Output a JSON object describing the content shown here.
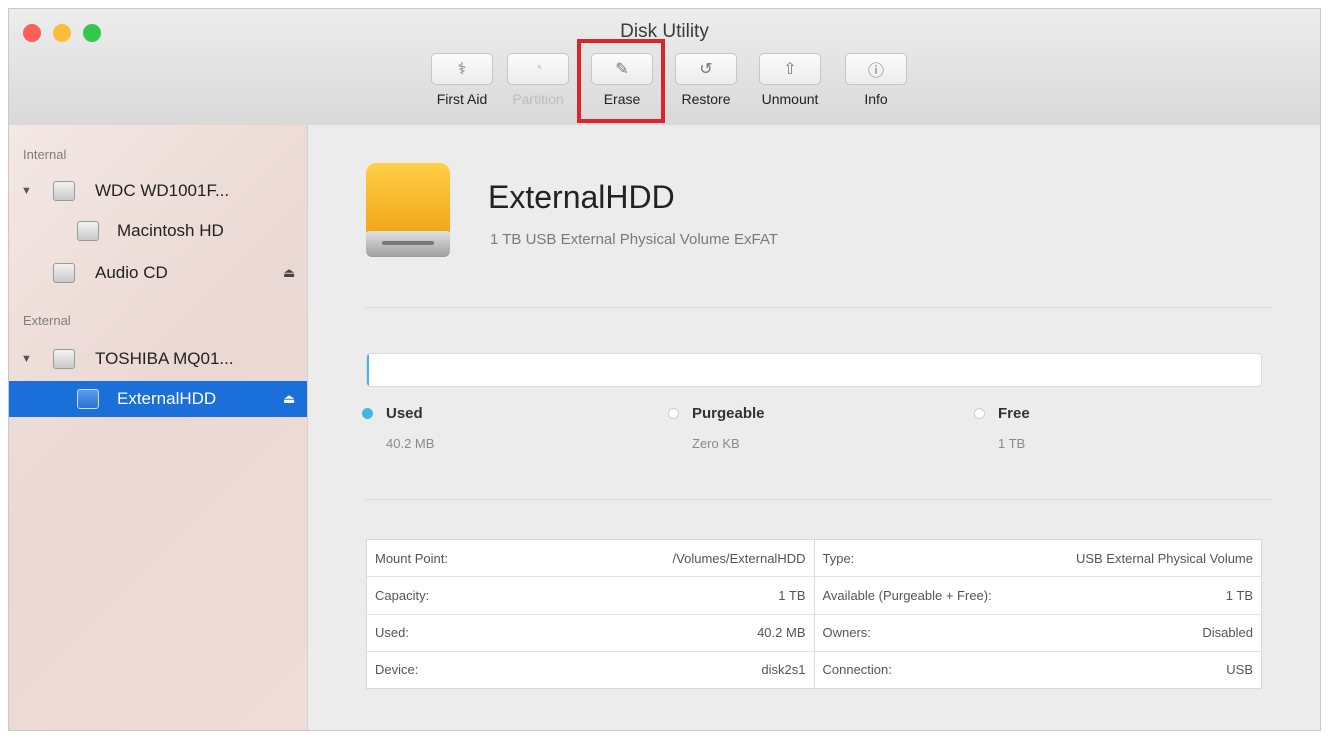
{
  "window": {
    "title": "Disk Utility"
  },
  "toolbar": {
    "buttons": [
      {
        "label": "First Aid",
        "icon": "stethoscope-icon",
        "glyph": "⚕",
        "enabled": true
      },
      {
        "label": "Partition",
        "icon": "partition-pie-icon",
        "glyph": "◔",
        "enabled": false
      },
      {
        "label": "Erase",
        "icon": "erase-icon",
        "glyph": "✎",
        "enabled": true,
        "highlighted": true
      },
      {
        "label": "Restore",
        "icon": "restore-icon",
        "glyph": "↺",
        "enabled": true
      },
      {
        "label": "Unmount",
        "icon": "unmount-icon",
        "glyph": "⇧",
        "enabled": true
      },
      {
        "label": "Info",
        "icon": "info-icon",
        "glyph": "ⓘ",
        "enabled": true
      }
    ],
    "highlight_color": "#d9262b"
  },
  "sidebar": {
    "sections": [
      {
        "header": "Internal",
        "items": [
          {
            "label": "WDC WD1001F...",
            "icon": "hard-drive-icon",
            "expanded": true,
            "indent": 0
          },
          {
            "label": "Macintosh HD",
            "icon": "volume-icon",
            "indent": 1
          },
          {
            "label": "Audio CD",
            "icon": "cd-icon",
            "indent": 0,
            "ejectable": true
          }
        ]
      },
      {
        "header": "External",
        "items": [
          {
            "label": "TOSHIBA MQ01...",
            "icon": "hard-drive-icon",
            "expanded": true,
            "indent": 0
          },
          {
            "label": "ExternalHDD",
            "icon": "volume-icon",
            "indent": 1,
            "selected": true,
            "ejectable": true
          }
        ]
      }
    ],
    "selection_color": "#1a6fd8"
  },
  "volume": {
    "name": "ExternalHDD",
    "description": "1 TB USB External Physical Volume ExFAT",
    "icon": "external-drive-icon",
    "used_fraction": 4e-05
  },
  "usage": {
    "used": {
      "label": "Used",
      "value": "40.2 MB",
      "color": "#3fb8e8"
    },
    "purgeable": {
      "label": "Purgeable",
      "value": "Zero KB",
      "color": "#ffffff"
    },
    "free": {
      "label": "Free",
      "value": "1 TB",
      "color": "#ffffff"
    }
  },
  "info": {
    "left": [
      {
        "label": "Mount Point:",
        "value": "/Volumes/ExternalHDD"
      },
      {
        "label": "Capacity:",
        "value": "1 TB"
      },
      {
        "label": "Used:",
        "value": "40.2 MB"
      },
      {
        "label": "Device:",
        "value": "disk2s1"
      }
    ],
    "right": [
      {
        "label": "Type:",
        "value": "USB External Physical Volume"
      },
      {
        "label": "Available (Purgeable + Free):",
        "value": "1 TB"
      },
      {
        "label": "Owners:",
        "value": "Disabled"
      },
      {
        "label": "Connection:",
        "value": "USB"
      }
    ]
  }
}
